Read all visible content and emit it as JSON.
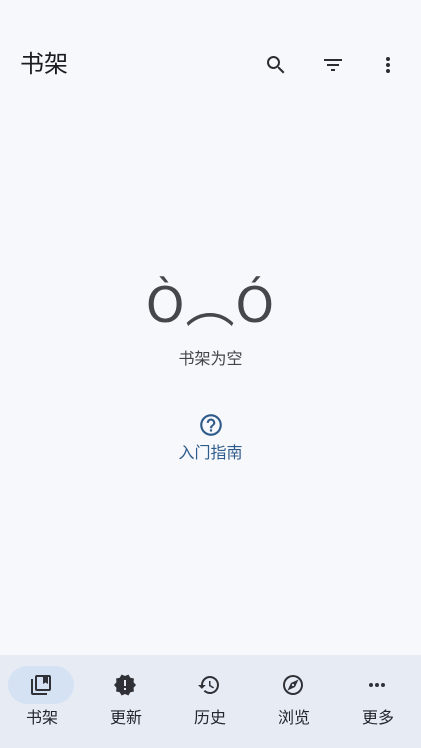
{
  "header": {
    "title": "书架"
  },
  "actions": {
    "search_icon": "search-icon",
    "filter_icon": "filter-icon",
    "more_icon": "more-vert-icon"
  },
  "empty_state": {
    "face": "Ò︵Ó",
    "message": "书架为空"
  },
  "guide": {
    "icon": "help-circle-icon",
    "label": "入门指南"
  },
  "bottom_nav": [
    {
      "label": "书架",
      "icon": "library-icon",
      "active": true
    },
    {
      "label": "更新",
      "icon": "new-releases-icon",
      "active": false
    },
    {
      "label": "历史",
      "icon": "history-icon",
      "active": false
    },
    {
      "label": "浏览",
      "icon": "compass-icon",
      "active": false
    },
    {
      "label": "更多",
      "icon": "more-horiz-icon",
      "active": false
    }
  ],
  "colors": {
    "background": "#f7f8fc",
    "nav_background": "#e6ebf4",
    "active_indicator": "#d5e2f4",
    "accent": "#2f5b8b",
    "text": "#1b1c20"
  }
}
